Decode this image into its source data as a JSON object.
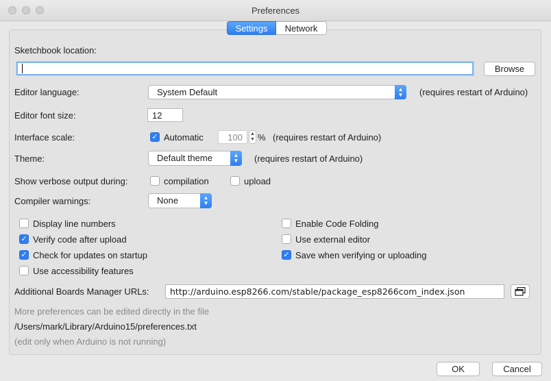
{
  "window": {
    "title": "Preferences"
  },
  "tabs": [
    {
      "label": "Settings",
      "active": true
    },
    {
      "label": "Network",
      "active": false
    }
  ],
  "sketchbook": {
    "label": "Sketchbook location:",
    "value": "",
    "browse_label": "Browse"
  },
  "editor_language": {
    "label": "Editor language:",
    "value": "System Default",
    "note": "(requires restart of Arduino)"
  },
  "editor_font_size": {
    "label": "Editor font size:",
    "value": "12"
  },
  "interface_scale": {
    "label": "Interface scale:",
    "automatic_label": "Automatic",
    "automatic_checked": true,
    "value": "100",
    "unit": "%",
    "note": "(requires restart of Arduino)"
  },
  "theme": {
    "label": "Theme:",
    "value": "Default theme",
    "note": "(requires restart of Arduino)"
  },
  "verbose": {
    "label": "Show verbose output during:",
    "compilation_label": "compilation",
    "compilation_checked": false,
    "upload_label": "upload",
    "upload_checked": false
  },
  "compiler_warnings": {
    "label": "Compiler warnings:",
    "value": "None"
  },
  "options_left": [
    {
      "label": "Display line numbers",
      "checked": false
    },
    {
      "label": "Verify code after upload",
      "checked": true
    },
    {
      "label": "Check for updates on startup",
      "checked": true
    },
    {
      "label": "Use accessibility features",
      "checked": false
    }
  ],
  "options_right": [
    {
      "label": "Enable Code Folding",
      "checked": false
    },
    {
      "label": "Use external editor",
      "checked": false
    },
    {
      "label": "Save when verifying or uploading",
      "checked": true
    }
  ],
  "boards_urls": {
    "label": "Additional Boards Manager URLs:",
    "value": "http://arduino.esp8266.com/stable/package_esp8266com_index.json"
  },
  "footer": {
    "more_prefs": "More preferences can be edited directly in the file",
    "path": "/Users/mark/Library/Arduino15/preferences.txt",
    "edit_note": "(edit only when Arduino is not running)"
  },
  "buttons": {
    "ok": "OK",
    "cancel": "Cancel"
  },
  "icons": {
    "check": "✓",
    "chevron_up": "▲",
    "chevron_down": "▼"
  },
  "colors": {
    "accent": "#2f7ef2",
    "focus_ring": "#7fb2f2"
  }
}
